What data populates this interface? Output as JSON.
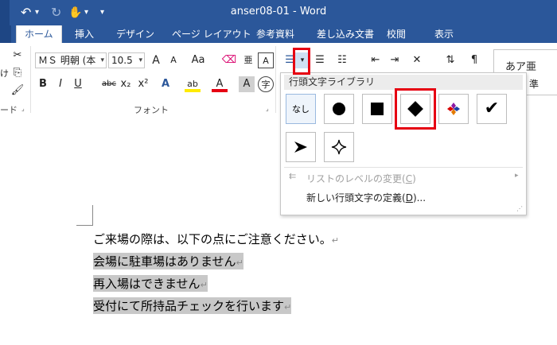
{
  "window": {
    "title": "anser08-01 - Word"
  },
  "quick_access": {
    "undo_glyph": "↶",
    "redo_glyph": "↻",
    "touch_glyph": "✋",
    "more_glyph": "▾"
  },
  "tabs": [
    {
      "label": "ホーム",
      "active": true
    },
    {
      "label": "挿入"
    },
    {
      "label": "デザイン"
    },
    {
      "label": "ページ レイアウト"
    },
    {
      "label": "参考資料"
    },
    {
      "label": "差し込み文書"
    },
    {
      "label": "校閲"
    },
    {
      "label": "表示"
    }
  ],
  "ribbon": {
    "font_name": "ＭＳ 明朝 (本",
    "font_size": "10.5",
    "grow_label": "A",
    "shrink_label": "A",
    "case_label": "Aa",
    "bold": "B",
    "italic": "I",
    "underline": "U",
    "strike": "abc",
    "sub": "x₂",
    "sup": "x²",
    "font_group_label": "フォント",
    "clipboard_group_label": "ード",
    "style_preview": "あア亜",
    "style_preview2": "準"
  },
  "dropdown": {
    "header": "行頭文字ライブラリ",
    "none_label": "なし",
    "change_level": "リストのレベルの変更(",
    "change_level_key": "C",
    "change_level_end": ")",
    "define_new": "新しい行頭文字の定義(",
    "define_new_key": "D",
    "define_new_end": ")..."
  },
  "document": {
    "lines": [
      {
        "text": "ご来場の際は、以下の点にご注意ください。",
        "highlight": false
      },
      {
        "text": "会場に駐車場はありません",
        "highlight": true
      },
      {
        "text": "再入場はできません",
        "highlight": true
      },
      {
        "text": "受付にて所持品チェックを行います",
        "highlight": true
      }
    ],
    "para_mark": "↵"
  },
  "colors": {
    "word_blue": "#2b579a",
    "annotation_red": "#e60012",
    "selection_gray": "#c8c8c8"
  }
}
